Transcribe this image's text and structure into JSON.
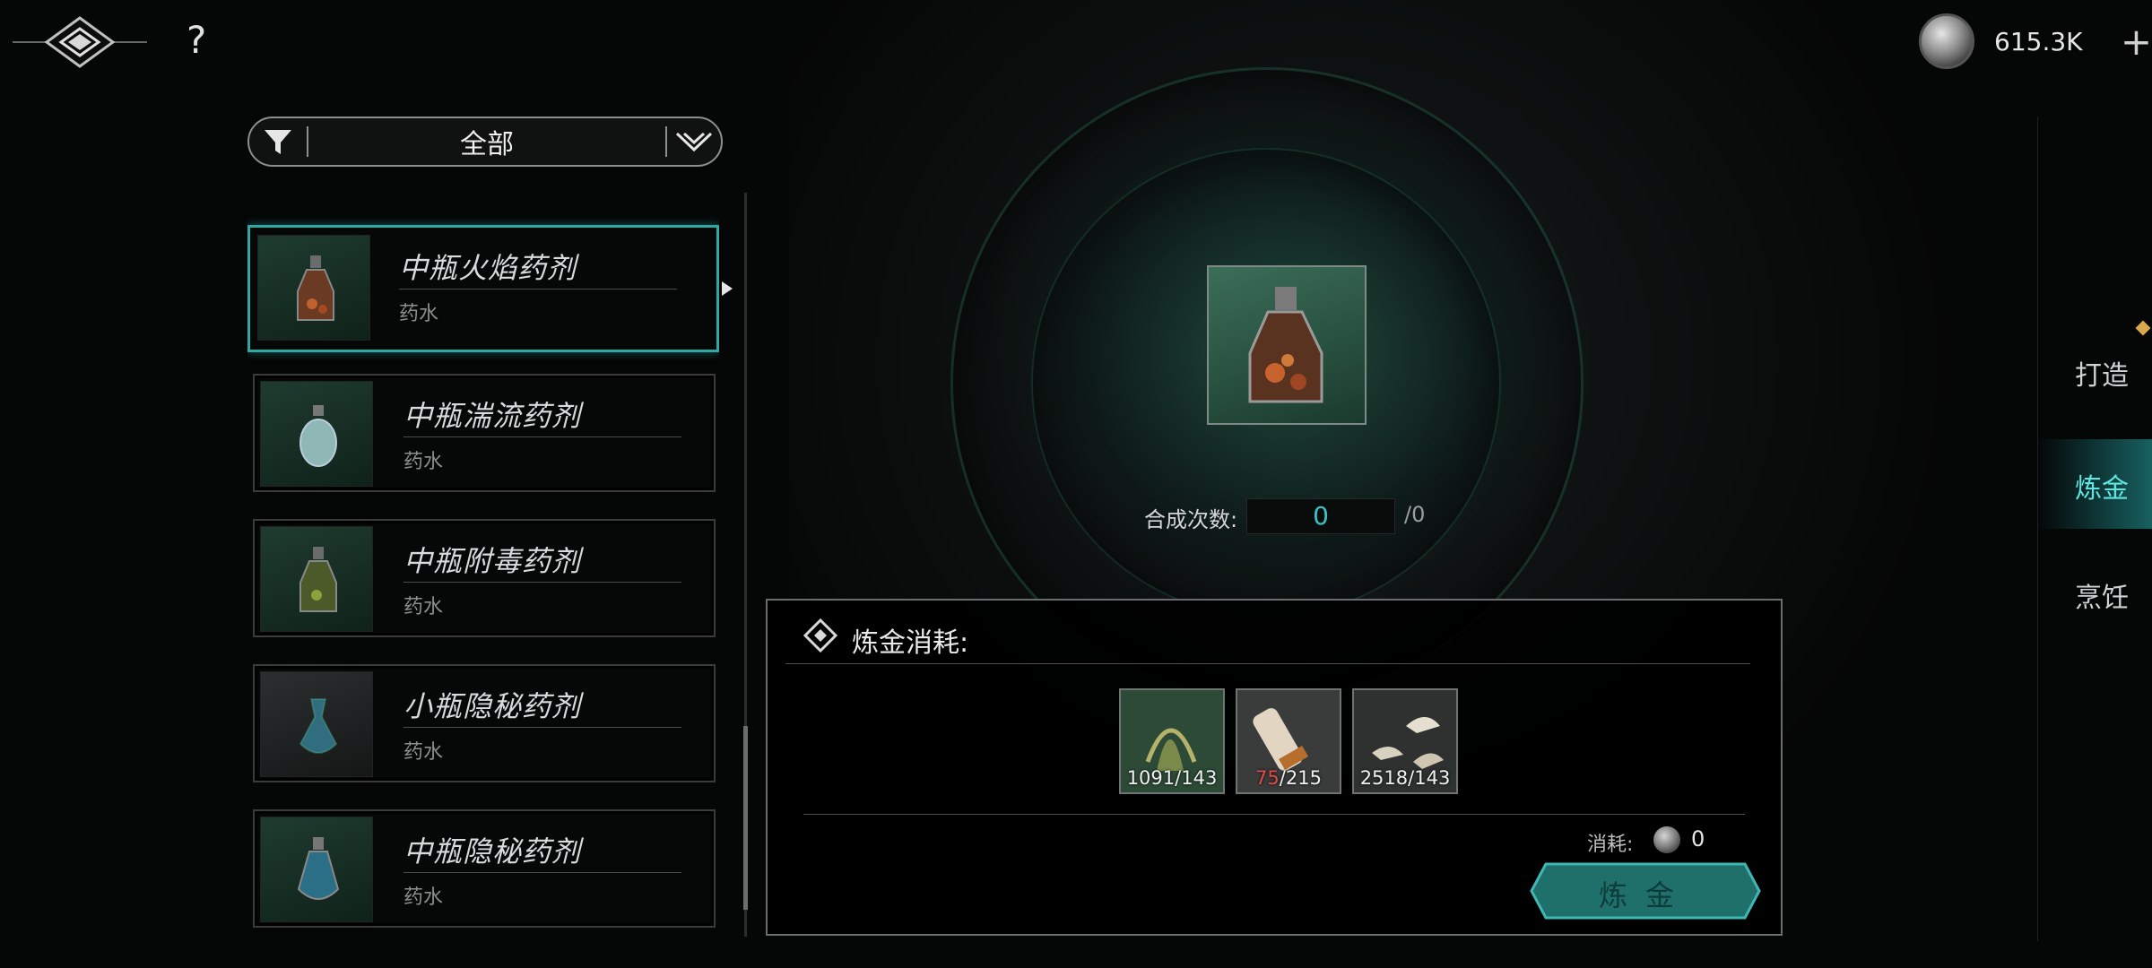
{
  "header": {
    "help_label": "?",
    "currency": {
      "amount": "615.3K",
      "add_label": "+"
    }
  },
  "filter": {
    "label": "全部"
  },
  "items": [
    {
      "name": "中瓶火焰药剂",
      "type": "药水",
      "selected": true
    },
    {
      "name": "中瓶湍流药剂",
      "type": "药水"
    },
    {
      "name": "中瓶附毒药剂",
      "type": "药水"
    },
    {
      "name": "小瓶隐秘药剂",
      "type": "药水"
    },
    {
      "name": "中瓶隐秘药剂",
      "type": "药水"
    }
  ],
  "synthesis": {
    "label": "合成次数:",
    "value": "0",
    "max": "/0"
  },
  "cost": {
    "title": "炼金消耗:",
    "materials": [
      {
        "icon": "herb-bundle-icon",
        "have": "1091",
        "need": "/143",
        "insufficient": false
      },
      {
        "icon": "scroll-icon",
        "have": "75",
        "need": "/215",
        "insufficient": true
      },
      {
        "icon": "fang-icon",
        "have": "2518",
        "need": "/143",
        "insufficient": false
      }
    ],
    "cost_label": "消耗:",
    "cost_value": "0",
    "craft_button": "炼金"
  },
  "tabs": [
    {
      "label": "打造"
    },
    {
      "label": "炼金",
      "active": true
    },
    {
      "label": "烹饪"
    }
  ],
  "colors": {
    "accent": "#2fa7a3",
    "active_tab": "#5ee7e2",
    "insufficient": "#e24a4a"
  }
}
